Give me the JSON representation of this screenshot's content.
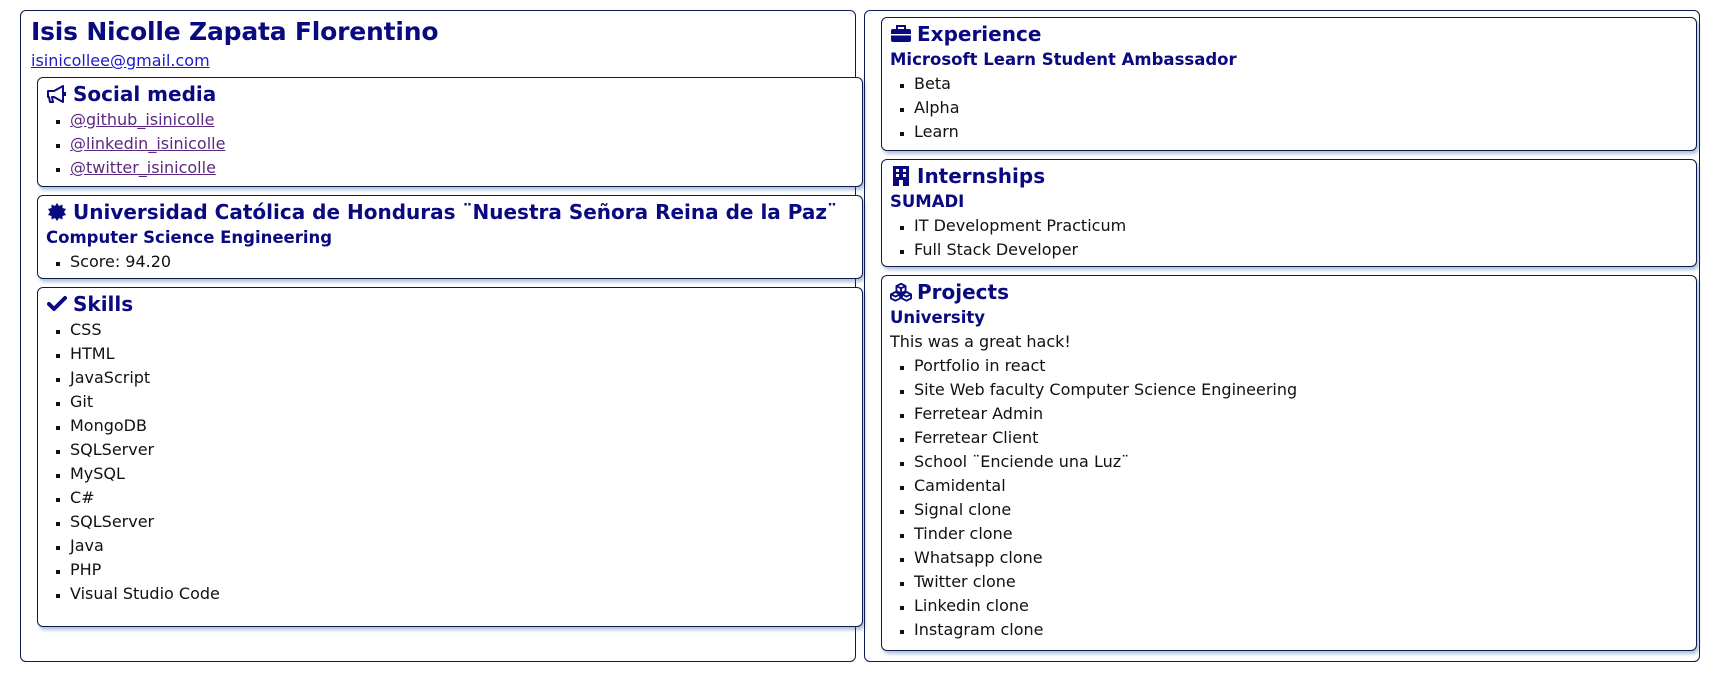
{
  "profile": {
    "name": "Isis Nicolle Zapata Florentino",
    "email": "isinicollee@gmail.com"
  },
  "social": {
    "title": "Social media",
    "icon": "megaphone-icon",
    "links": [
      "@github_isinicolle",
      "@linkedin_isinicolle",
      "@twitter_isinicolle"
    ]
  },
  "education": {
    "title": "Universidad Católica de Honduras ¨Nuestra Señora Reina de la Paz¨",
    "icon": "badge-icon",
    "degree": "Computer Science Engineering",
    "items": [
      "Score: 94.20"
    ]
  },
  "skills": {
    "title": "Skills",
    "icon": "check-icon",
    "items": [
      "CSS",
      "HTML",
      "JavaScript",
      "Git",
      "MongoDB",
      "SQLServer",
      "MySQL",
      "C#",
      "SQLServer",
      "Java",
      "PHP",
      "Visual Studio Code"
    ]
  },
  "experience": {
    "title": "Experience",
    "icon": "briefcase-icon",
    "role": "Microsoft Learn Student Ambassador",
    "items": [
      "Beta",
      "Alpha",
      "Learn"
    ]
  },
  "internships": {
    "title": "Internships",
    "icon": "building-icon",
    "company": "SUMADI",
    "items": [
      "IT Development Practicum",
      "Full Stack Developer"
    ]
  },
  "projects": {
    "title": "Projects",
    "icon": "cubes-icon",
    "group": "University",
    "description": "This was a great hack!",
    "items": [
      "Portfolio in react",
      "Site Web faculty Computer Science Engineering",
      "Ferretear Admin",
      "Ferretear Client",
      "School ¨Enciende una Luz¨",
      "Camidental",
      "Signal clone",
      "Tinder clone",
      "Whatsapp clone",
      "Twitter clone",
      "Linkedin clone",
      "Instagram clone"
    ]
  }
}
